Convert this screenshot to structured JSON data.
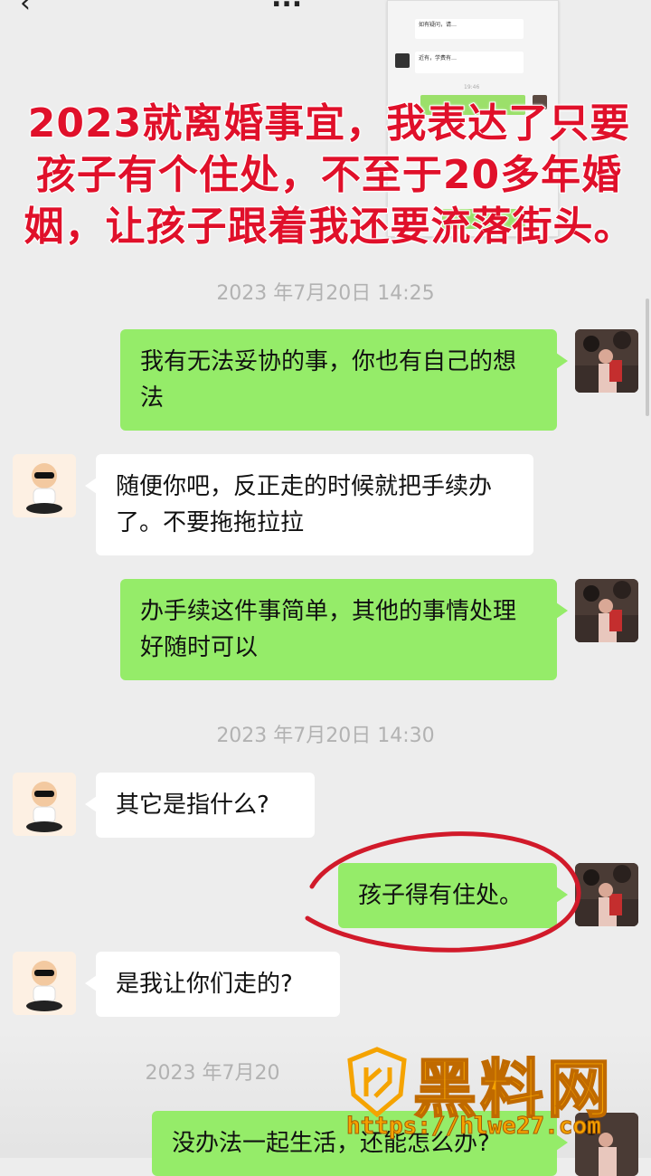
{
  "header": {
    "back_icon": "chevron-left-icon",
    "title": "..."
  },
  "headline": "2023就离婚事宜，我表达了只要孩子有个住处，不至于20多年婚姻，让孩子跟着我还要流落街头。",
  "mini_screenshot": {
    "line1": "如有疑问，请…",
    "line2": "近有，学费有…",
    "time": "19:46",
    "reply": "…"
  },
  "messages": [
    {
      "type": "time",
      "text": "2023 年7月20日 14:25"
    },
    {
      "type": "sent",
      "text": "我有无法妥协的事，你也有自己的想法"
    },
    {
      "type": "received",
      "text": "随便你吧，反正走的时候就把手续办了。不要拖拖拉拉"
    },
    {
      "type": "sent",
      "text": "办手续这件事简单，其他的事情处理好随时可以"
    },
    {
      "type": "time",
      "text": "2023 年7月20日 14:30"
    },
    {
      "type": "received",
      "text": "其它是指什么?"
    },
    {
      "type": "sent",
      "text": "孩子得有住处。"
    },
    {
      "type": "received",
      "text": "是我让你们走的?"
    },
    {
      "type": "time",
      "text": "2023 年7月20"
    },
    {
      "type": "sent",
      "text": "没办法一起生活，还能怎么办?"
    }
  ],
  "watermark": {
    "brand": "黑料网",
    "url": "https://hlwe27.com"
  },
  "colors": {
    "background": "#ededed",
    "sent_bubble": "#95ec69",
    "received_bubble": "#ffffff",
    "headline": "#e0102a",
    "annotation_circle": "#d11a2a",
    "watermark": "#f5a300"
  }
}
